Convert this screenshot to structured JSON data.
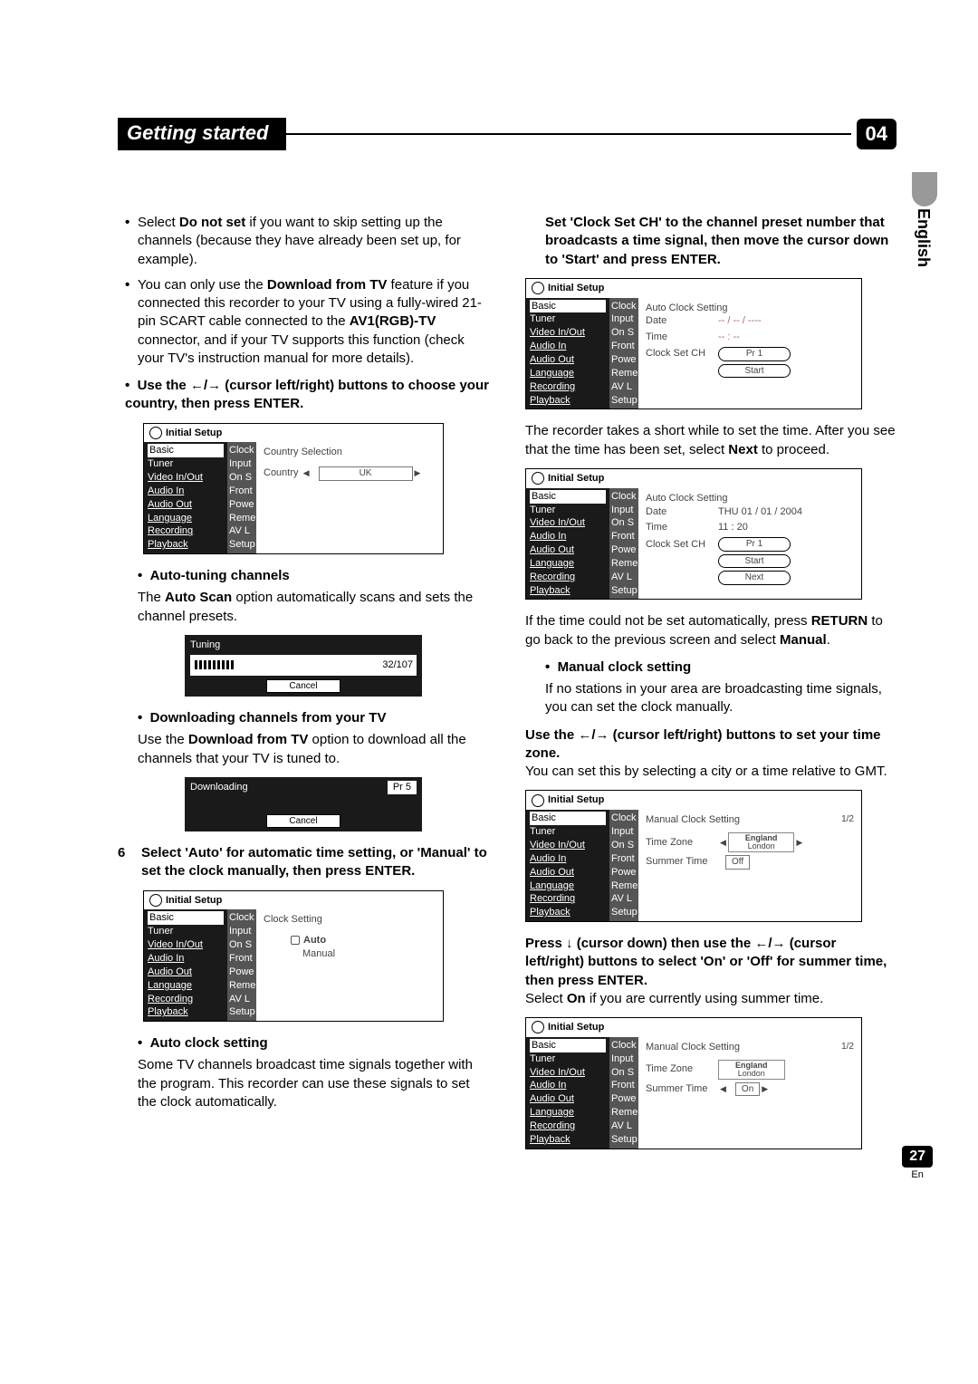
{
  "header": {
    "title": "Getting started",
    "chapter": "04"
  },
  "lang_tab": "English",
  "left": {
    "p1a": "Select ",
    "p1b": "Do not set",
    "p1c": " if you want to skip setting up the channels (because they have already been set up, for example).",
    "p2a": "You can only use the ",
    "p2b": "Download from TV",
    "p2c": " feature if you connected this recorder to your TV using a fully-wired 21-pin SCART cable connected to the ",
    "p2d": "AV1(RGB)-TV",
    "p2e": " connector, and if your TV supports this function (check your TV's instruction manual for more details).",
    "use_arrows": "Use the ←/→ (cursor left/right) buttons to choose your country, then press ENTER.",
    "auto_tune_h": "Auto-tuning channels",
    "auto_tune_p1": "The ",
    "auto_tune_p2": "Auto Scan",
    "auto_tune_p3": " option automatically scans and sets the channel presets.",
    "dl_h": "Downloading channels from your TV",
    "dl_p1": "Use the ",
    "dl_p2": "Download from TV",
    "dl_p3": " option to download all the channels that your TV is tuned to.",
    "step6_n": "6",
    "step6_t": "Select 'Auto' for automatic time setting, or 'Manual' to set the clock manually, then press ENTER.",
    "auto_clock_h": "Auto clock setting",
    "auto_clock_p": "Some TV channels broadcast time signals together with the program. This recorder can use these signals to set the clock automatically."
  },
  "right": {
    "intro": "Set 'Clock Set CH' to the channel preset number that broadcasts a time signal, then move the cursor down to 'Start' and press ENTER.",
    "after1": "The recorder takes a short while to set the time. After you see that the time has been set, select ",
    "after2": "Next",
    "after3": " to proceed.",
    "ifnot1": "If the time could not be set automatically, press ",
    "ifnot2": "RETURN",
    "ifnot3": " to go back to the previous screen and select ",
    "ifnot4": "Manual",
    "manual_h": "Manual clock setting",
    "manual_p": "If no stations in your area are broadcasting time signals, you can set the clock manually.",
    "tz_h": "Use the ←/→ (cursor left/right) buttons to set your time zone.",
    "tz_p": "You can set this by selecting a city or a time relative to GMT.",
    "summer_h": "Press ↓ (cursor down) then use the ←/→ (cursor left/right) buttons to select 'On' or 'Off' for summer time, then press ENTER.",
    "summer_p1": "Select ",
    "summer_p2": "On",
    "summer_p3": " if you are currently using summer time."
  },
  "osd": {
    "title": "Initial Setup",
    "menu": [
      "Basic",
      "Tuner",
      "Video In/Out",
      "Audio In",
      "Audio Out",
      "Language",
      "Recording",
      "Playback"
    ],
    "mid": [
      "Clock",
      "Input",
      "On S",
      "Front",
      "Powe",
      "Reme",
      "AV L",
      "Setup"
    ],
    "country_h": "Country Selection",
    "country_l": "Country",
    "country_v": "UK",
    "tuning": {
      "title": "Tuning",
      "progress": "32/107",
      "cancel": "Cancel"
    },
    "download": {
      "title": "Downloading",
      "pr": "Pr 5",
      "cancel": "Cancel"
    },
    "clockset_h": "Clock Setting",
    "auto": "Auto",
    "manual": "Manual",
    "auto_clock_h": "Auto Clock Setting",
    "date_l": "Date",
    "date_blank": "-- / -- / ----",
    "time_l": "Time",
    "time_blank": "-- : --",
    "clockch_l": "Clock Set CH",
    "pr1": "Pr 1",
    "start": "Start",
    "date_set": "THU  01 / 01 / 2004",
    "time_set": "11 : 20",
    "next": "Next",
    "manual_clock_h": "Manual Clock Setting",
    "page_frac": "1/2",
    "tz_l": "Time Zone",
    "tz_v1": "England",
    "tz_v2": "London",
    "summer_l": "Summer Time",
    "off": "Off",
    "on": "On"
  },
  "footer": {
    "page": "27",
    "lang": "En"
  }
}
